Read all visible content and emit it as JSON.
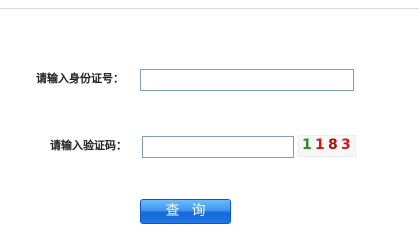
{
  "form": {
    "id_number_label": "请输入身份证号：",
    "id_number_value": "",
    "verification_label": "请输入验证码：",
    "verification_value": "",
    "captcha": {
      "digits": [
        {
          "char": "1",
          "color": "#2e8b2e"
        },
        {
          "char": "1",
          "color": "#cc1a1a"
        },
        {
          "char": "8",
          "color": "#b01010"
        },
        {
          "char": "3",
          "color": "#cc1a1a"
        }
      ]
    },
    "query_button_label": "查询"
  },
  "colors": {
    "button_top": "#6bbcff",
    "button_bottom": "#1668d8",
    "input_border": "#7f9db9"
  }
}
